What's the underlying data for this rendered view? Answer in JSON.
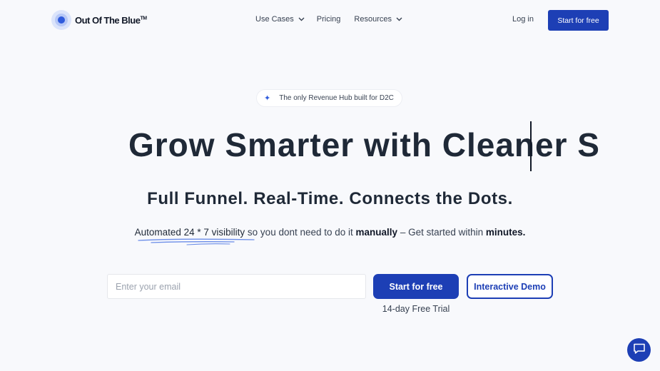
{
  "brand": {
    "name": "Out Of The Blue",
    "tm": "TM"
  },
  "nav": {
    "use_cases": "Use Cases",
    "pricing": "Pricing",
    "resources": "Resources",
    "login": "Log in",
    "cta": "Start for free"
  },
  "hero": {
    "badge": "The only Revenue Hub built for D2C",
    "badge_icon": "sparkle-icon",
    "headline": "Grow Smarter with Cleaner S",
    "subhead": "Full Funnel. Real-Time. Connects the Dots.",
    "tagline": {
      "highlight": "Automated 24 * 7 visibility",
      "middle": " so you dont need to do it ",
      "bold1": "manually",
      "middle2": " – Get started within ",
      "bold2": "minutes."
    }
  },
  "form": {
    "email_placeholder": "Enter your email",
    "cta": "Start for free",
    "demo": "Interactive Demo",
    "trial": "14-day Free Trial"
  },
  "chat": {
    "icon": "chat-icon"
  },
  "colors": {
    "primary": "#1d3fb5",
    "background": "#f8f9fc",
    "accent": "#2f5bdc"
  }
}
